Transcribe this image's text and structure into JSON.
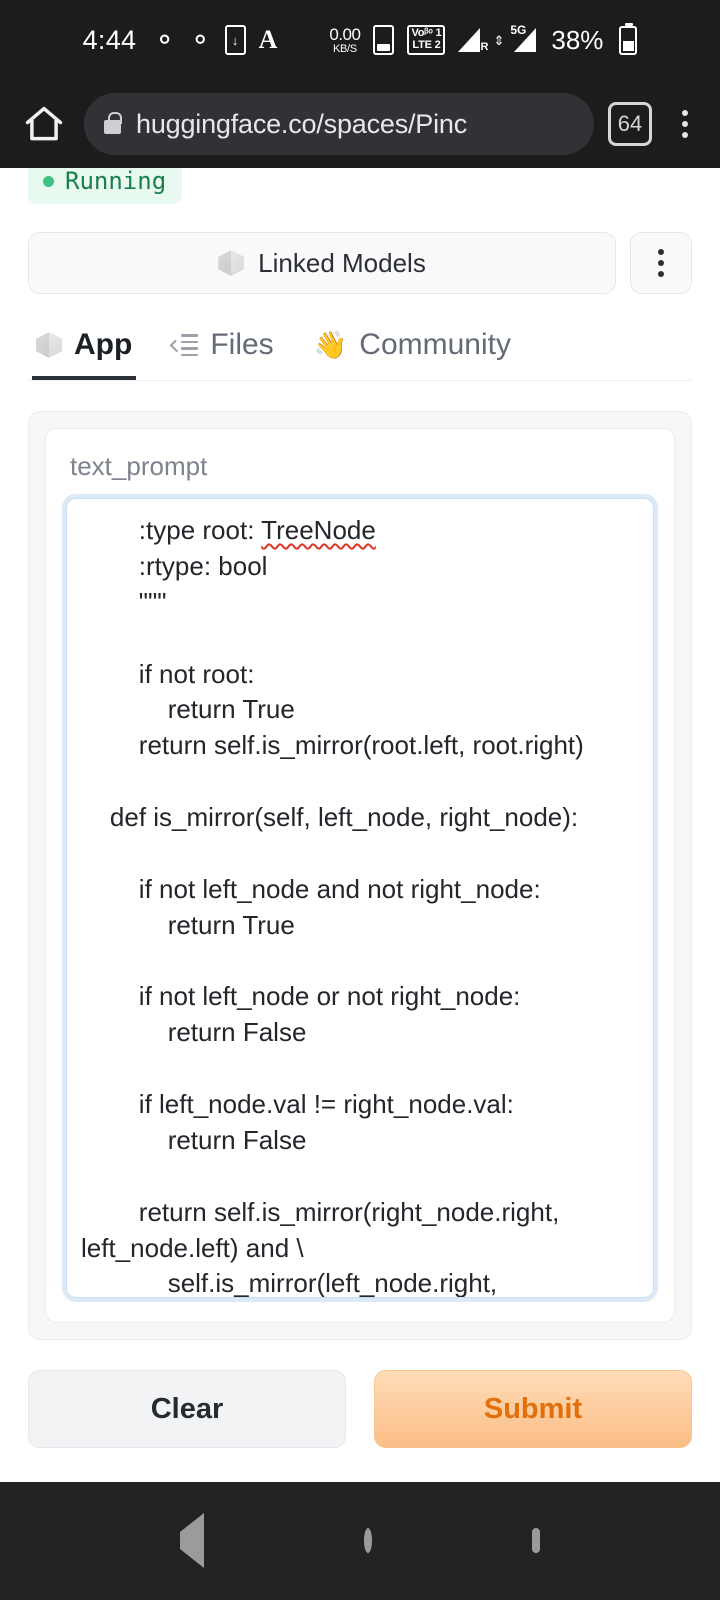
{
  "status_bar": {
    "time": "4:44",
    "icons": [
      "gmail-icon",
      "gmail-icon",
      "download-icon",
      "font-size-icon"
    ],
    "font_glyph": "A",
    "network_speed_value": "0.00",
    "network_speed_unit": "KB/S",
    "sim_icon": "sim-card-icon",
    "volte_line1": "Voᵝᵒ 1",
    "volte_line2": "LTE 2",
    "signal_sub": "R",
    "signal_5g": "5G",
    "battery_percent": "38%"
  },
  "browser": {
    "home_icon": "home-icon",
    "lock_icon": "lock-icon",
    "url": "huggingface.co/spaces/Pinc",
    "tab_count": "64",
    "menu_icon": "kebab-menu-icon"
  },
  "space": {
    "status_label": "Running",
    "linked_models_label": "Linked Models",
    "linked_models_icon": "cube-icon",
    "more_icon": "kebab-menu-icon"
  },
  "tabs": [
    {
      "label": "App",
      "icon": "cube-icon",
      "active": true
    },
    {
      "label": "Files",
      "icon": "files-icon",
      "active": false
    },
    {
      "label": "Community",
      "icon": "waving-hand-icon",
      "active": false
    }
  ],
  "form": {
    "field_label": "text_prompt",
    "code_line_1": "        :type root: ",
    "code_misspelled_word": "TreeNode",
    "code_body": "\n        :rtype: bool\n        \"\"\"\n\n        if not root:\n            return True\n        return self.is_mirror(root.left, root.right)\n\n    def is_mirror(self, left_node, right_node):\n\n        if not left_node and not right_node:\n            return True\n\n        if not left_node or not right_node:\n            return False\n\n        if left_node.val != right_node.val:\n            return False\n\n        return self.is_mirror(right_node.right, left_node.left) and \\\n            self.is_mirror(left_node.right, right_node.left)"
  },
  "actions": {
    "clear_label": "Clear",
    "submit_label": "Submit"
  },
  "nav_bar": {
    "back_icon": "back-triangle-icon",
    "home_icon": "home-circle-icon",
    "recents_icon": "recents-square-icon"
  },
  "colors": {
    "status_green": "#1a7f4b",
    "status_green_bg": "#e8f9ef",
    "submit_text": "#e1700c",
    "focus_ring": "#dceaf8",
    "dark_chrome": "#1c1c1c"
  }
}
